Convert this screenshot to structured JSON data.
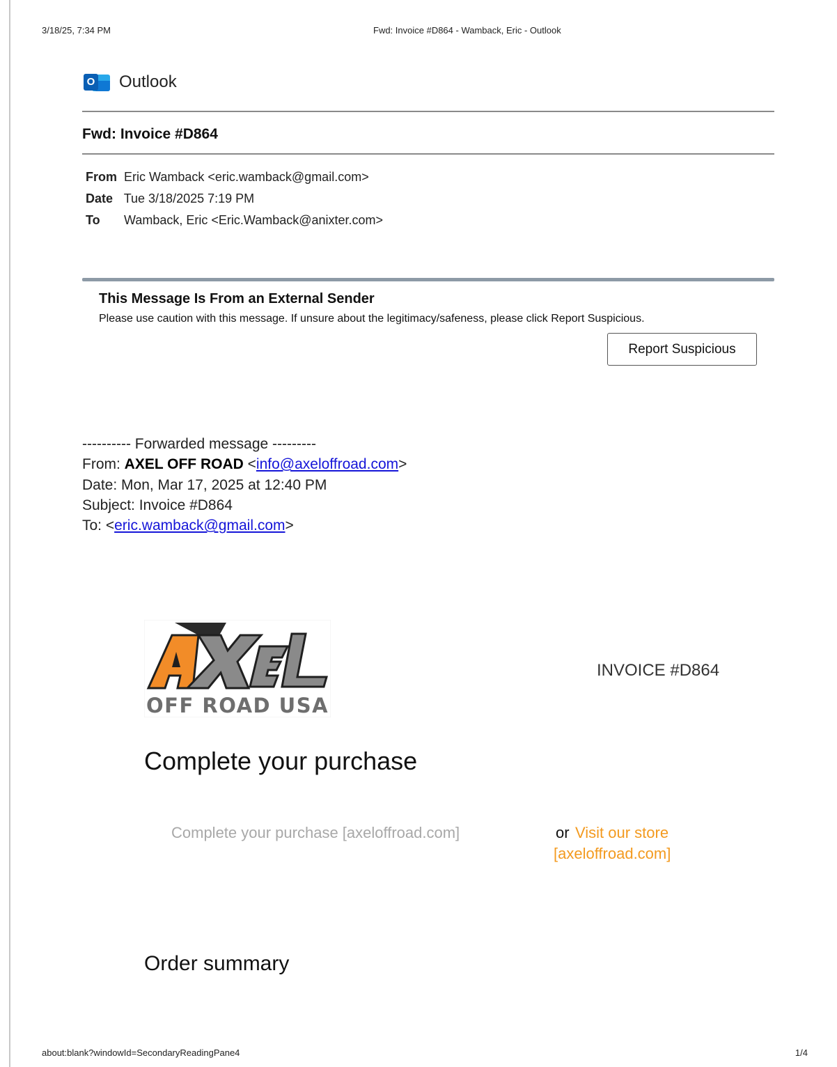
{
  "print": {
    "header_left": "3/18/25, 7:34 PM",
    "header_center": "Fwd: Invoice #D864 - Wamback, Eric - Outlook",
    "footer_left": "about:blank?windowId=SecondaryReadingPane4",
    "footer_right": "1/4"
  },
  "app": {
    "name": "Outlook",
    "icon": "outlook-logo-icon",
    "icon_letter": "O"
  },
  "message": {
    "subject": "Fwd: Invoice #D864",
    "from_label": "From",
    "from": "Eric Wamback <eric.wamback@gmail.com>",
    "date_label": "Date",
    "date": "Tue 3/18/2025 7:19 PM",
    "to_label": "To",
    "to": "Wamback, Eric <Eric.Wamback@anixter.com>"
  },
  "external_banner": {
    "title": "This Message Is From an External Sender",
    "text": "Please use caution with this message. If unsure about the legitimacy/safeness, please click Report Suspicious.",
    "button": "Report Suspicious"
  },
  "forwarded": {
    "divider": "---------- Forwarded message ---------",
    "from_prefix": "From: ",
    "from_name": "AXEL OFF ROAD",
    "from_email": "info@axeloffroad.com",
    "date_line": "Date: Mon, Mar 17, 2025 at 12:40 PM",
    "subject_line": "Subject: Invoice #D864",
    "to_prefix": "To: ",
    "to_email": "eric.wamback@gmail.com"
  },
  "body": {
    "logo_word": "AXEL",
    "logo_tagline": "OFF ROAD USA",
    "invoice_number": "INVOICE #D864",
    "heading": "Complete your purchase",
    "complete_link": "Complete your purchase [axeloffroad.com]",
    "or": "or",
    "store_link_line1": "Visit our store",
    "store_link_line2": "[axeloffroad.com]",
    "order_summary": "Order summary"
  },
  "colors": {
    "link": "#1515d8",
    "accent_orange": "#f39a1f",
    "banner_bar": "#8d9aa6",
    "logo_gray": "#6e6e6e"
  }
}
